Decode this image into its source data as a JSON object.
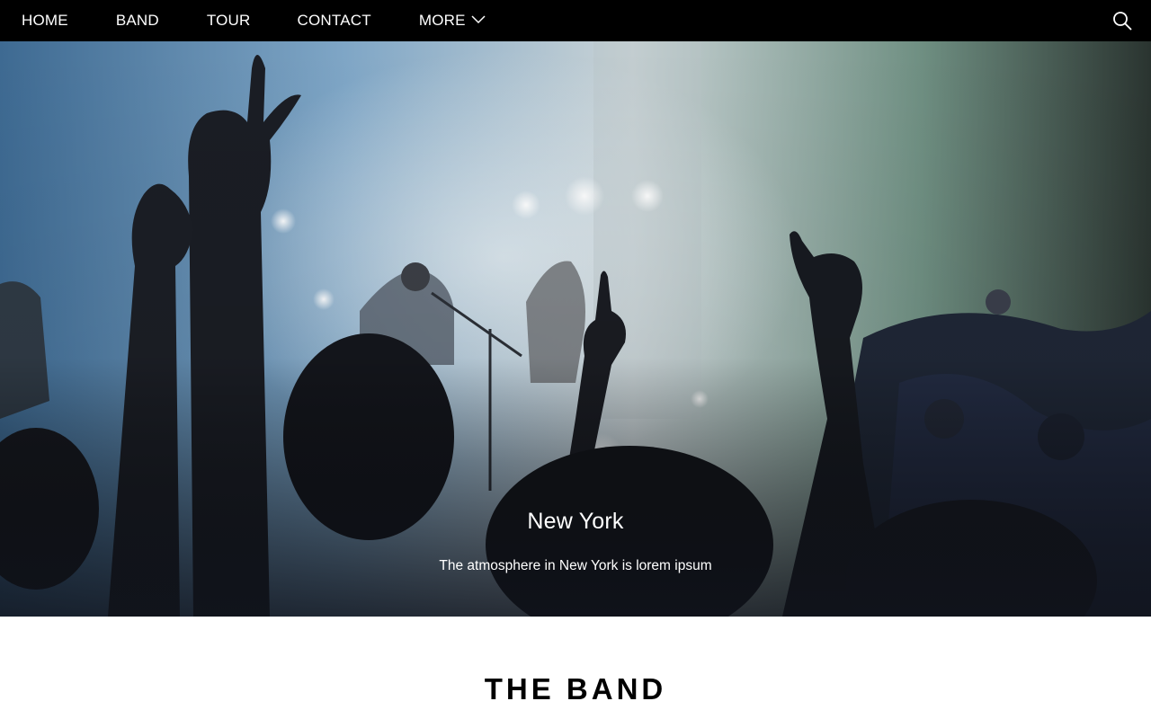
{
  "nav": {
    "items": [
      {
        "label": "HOME"
      },
      {
        "label": "BAND"
      },
      {
        "label": "TOUR"
      },
      {
        "label": "CONTACT"
      },
      {
        "label": "MORE"
      }
    ],
    "more_icon": "chevron-down-icon",
    "search_icon": "search-icon"
  },
  "hero": {
    "title": "New York",
    "text": "The atmosphere in New York is lorem ipsum"
  },
  "section": {
    "title": "THE BAND"
  },
  "colors": {
    "nav_bg": "#000000",
    "nav_text": "#ffffff",
    "caption_text": "#ffffff",
    "section_title": "#000000"
  }
}
